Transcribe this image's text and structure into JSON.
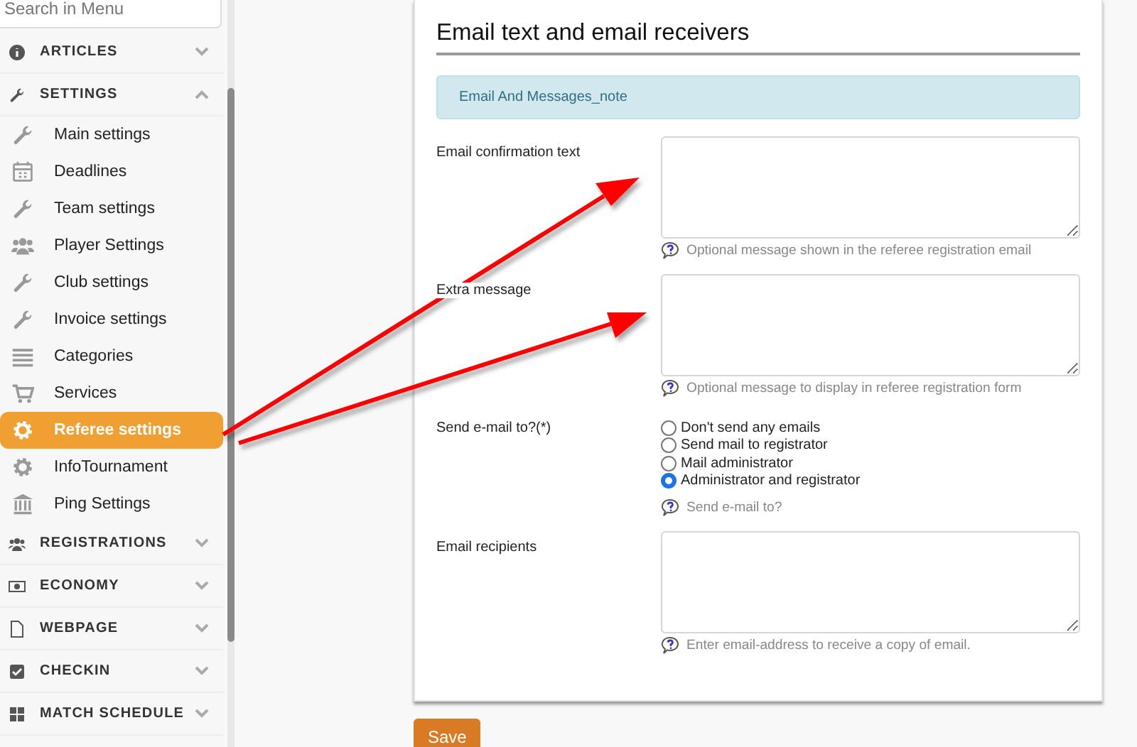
{
  "sidebar": {
    "search": {
      "placeholder": "Search in Menu"
    },
    "sections": [
      {
        "label": "ARTICLES",
        "expanded": false
      },
      {
        "label": "SETTINGS",
        "expanded": true,
        "items": [
          {
            "label": "Main settings",
            "selected": false
          },
          {
            "label": "Deadlines",
            "selected": false
          },
          {
            "label": "Team settings",
            "selected": false
          },
          {
            "label": "Player Settings",
            "selected": false
          },
          {
            "label": "Club settings",
            "selected": false
          },
          {
            "label": "Invoice settings",
            "selected": false
          },
          {
            "label": "Categories",
            "selected": false
          },
          {
            "label": "Services",
            "selected": false
          },
          {
            "label": "Referee settings",
            "selected": true
          },
          {
            "label": "InfoTournament",
            "selected": false
          },
          {
            "label": "Ping Settings",
            "selected": false
          }
        ]
      },
      {
        "label": "REGISTRATIONS",
        "expanded": false
      },
      {
        "label": "ECONOMY",
        "expanded": false
      },
      {
        "label": "WEBPAGE",
        "expanded": false
      },
      {
        "label": "CHECKIN",
        "expanded": false
      },
      {
        "label": "MATCH SCHEDULE",
        "expanded": false
      }
    ]
  },
  "card": {
    "title": "Email text and email receivers",
    "note": "Email And Messages_note",
    "fields": [
      {
        "kind": "textarea",
        "label": "Email confirmation text",
        "help": "Optional message shown in the referee registration email"
      },
      {
        "kind": "textarea",
        "label": "Extra message",
        "help": "Optional message to display in referee registration form"
      },
      {
        "kind": "radio",
        "label": "Send e-mail to?(*)",
        "help": "Send e-mail to?",
        "options": [
          {
            "label": "Don't send any emails",
            "selected": false
          },
          {
            "label": "Send mail to registrator",
            "selected": false
          },
          {
            "label": "Mail administrator",
            "selected": false
          },
          {
            "label": "Administrator and registrator",
            "selected": true
          }
        ]
      },
      {
        "kind": "textarea",
        "label": "Email recipients",
        "help": "Enter email-address to receive a copy of email."
      }
    ]
  },
  "save_button": "Save"
}
